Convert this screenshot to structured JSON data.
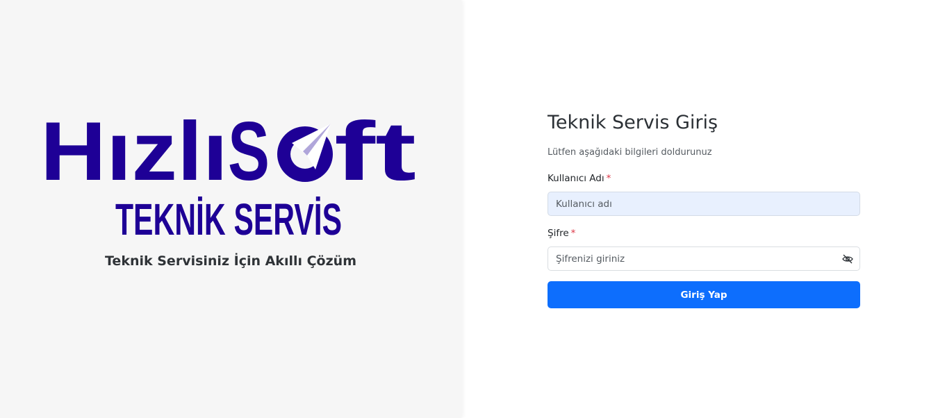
{
  "brand": {
    "logo_word_1": "Hızlı",
    "logo_word_2": "S",
    "logo_word_3": "ft",
    "logo_subtitle": "TEKNİK SERVİS",
    "tagline": "Teknik Servisiniz İçin Akıllı Çözüm",
    "logo_color": "#1e0096",
    "logo_accent": "#ffffff"
  },
  "login": {
    "title": "Teknik Servis Giriş",
    "subtitle": "Lütfen aşağıdaki bilgileri doldurunuz",
    "username_label": "Kullanıcı Adı",
    "username_placeholder": "Kullanıcı adı",
    "password_label": "Şifre",
    "password_placeholder": "Şifrenizi giriniz",
    "required_marker": "*",
    "submit_label": "Giriş Yap",
    "password_toggle_icon": "eye-slash-icon",
    "primary_color": "#0d6efd"
  }
}
